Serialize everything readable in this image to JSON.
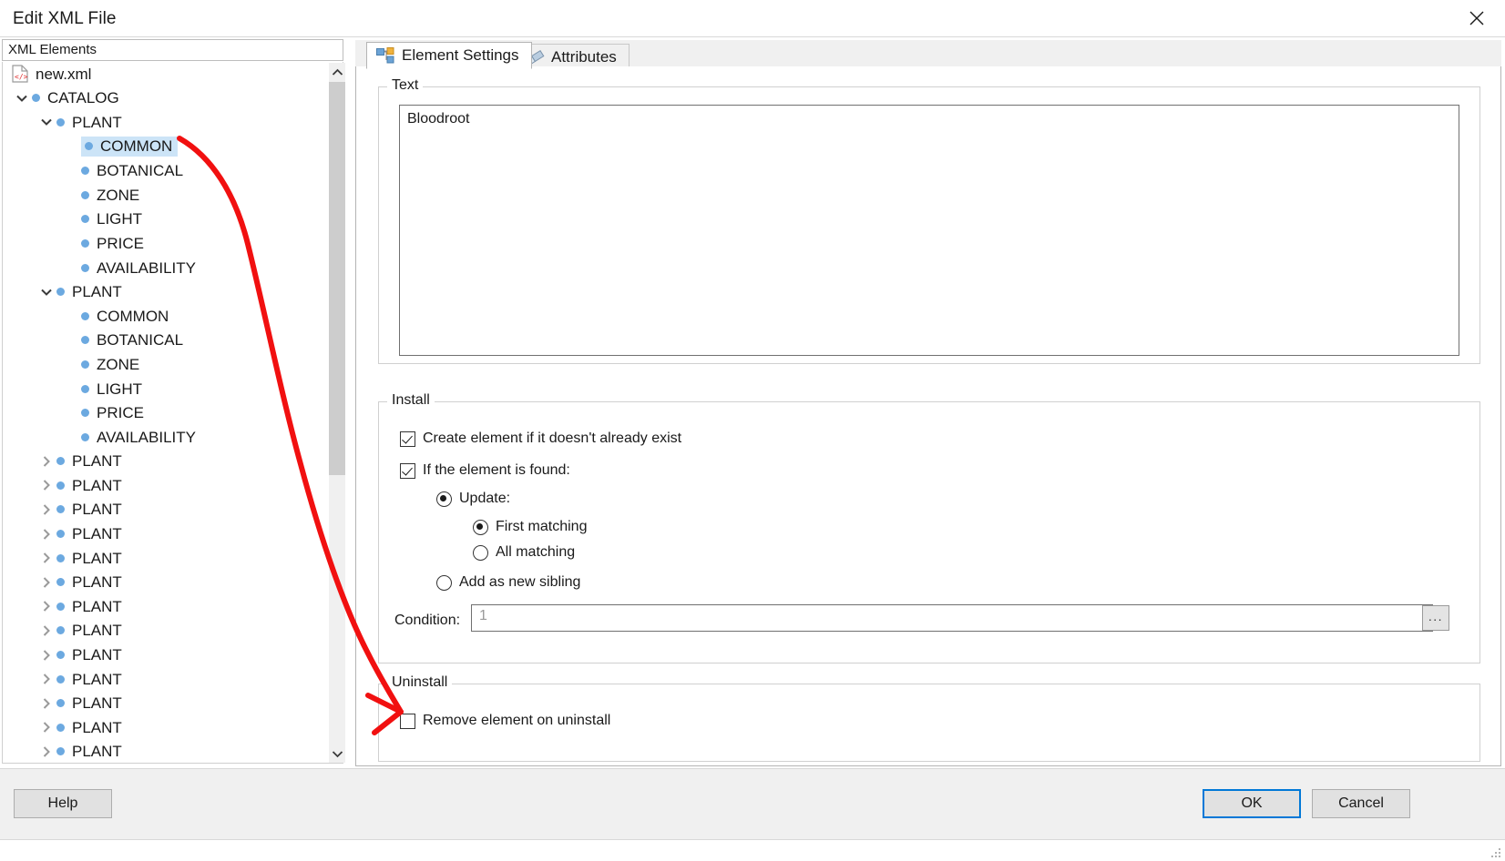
{
  "window": {
    "title": "Edit XML File",
    "close_icon": "close-icon"
  },
  "tree_panel": {
    "header_label": "XML Elements",
    "root": {
      "label": "new.xml",
      "icon": "xml-file-icon"
    },
    "nodes": [
      {
        "label": "CATALOG",
        "depth": 1,
        "state": "expanded",
        "selected": false
      },
      {
        "label": "PLANT",
        "depth": 2,
        "state": "expanded",
        "selected": false
      },
      {
        "label": "COMMON",
        "depth": 3,
        "state": "leaf",
        "selected": true
      },
      {
        "label": "BOTANICAL",
        "depth": 3,
        "state": "leaf",
        "selected": false
      },
      {
        "label": "ZONE",
        "depth": 3,
        "state": "leaf",
        "selected": false
      },
      {
        "label": "LIGHT",
        "depth": 3,
        "state": "leaf",
        "selected": false
      },
      {
        "label": "PRICE",
        "depth": 3,
        "state": "leaf",
        "selected": false
      },
      {
        "label": "AVAILABILITY",
        "depth": 3,
        "state": "leaf",
        "selected": false
      },
      {
        "label": "PLANT",
        "depth": 2,
        "state": "expanded",
        "selected": false
      },
      {
        "label": "COMMON",
        "depth": 3,
        "state": "leaf",
        "selected": false
      },
      {
        "label": "BOTANICAL",
        "depth": 3,
        "state": "leaf",
        "selected": false
      },
      {
        "label": "ZONE",
        "depth": 3,
        "state": "leaf",
        "selected": false
      },
      {
        "label": "LIGHT",
        "depth": 3,
        "state": "leaf",
        "selected": false
      },
      {
        "label": "PRICE",
        "depth": 3,
        "state": "leaf",
        "selected": false
      },
      {
        "label": "AVAILABILITY",
        "depth": 3,
        "state": "leaf",
        "selected": false
      },
      {
        "label": "PLANT",
        "depth": 2,
        "state": "collapsed",
        "selected": false
      },
      {
        "label": "PLANT",
        "depth": 2,
        "state": "collapsed",
        "selected": false
      },
      {
        "label": "PLANT",
        "depth": 2,
        "state": "collapsed",
        "selected": false
      },
      {
        "label": "PLANT",
        "depth": 2,
        "state": "collapsed",
        "selected": false
      },
      {
        "label": "PLANT",
        "depth": 2,
        "state": "collapsed",
        "selected": false
      },
      {
        "label": "PLANT",
        "depth": 2,
        "state": "collapsed",
        "selected": false
      },
      {
        "label": "PLANT",
        "depth": 2,
        "state": "collapsed",
        "selected": false
      },
      {
        "label": "PLANT",
        "depth": 2,
        "state": "collapsed",
        "selected": false
      },
      {
        "label": "PLANT",
        "depth": 2,
        "state": "collapsed",
        "selected": false
      },
      {
        "label": "PLANT",
        "depth": 2,
        "state": "collapsed",
        "selected": false
      },
      {
        "label": "PLANT",
        "depth": 2,
        "state": "collapsed",
        "selected": false
      },
      {
        "label": "PLANT",
        "depth": 2,
        "state": "collapsed",
        "selected": false
      },
      {
        "label": "PLANT",
        "depth": 2,
        "state": "collapsed",
        "selected": false
      }
    ],
    "scrollbar": {
      "up_icon": "chevron-up-icon",
      "down_icon": "chevron-down-icon"
    }
  },
  "tabs": [
    {
      "label": "Element Settings",
      "icon": "element-tree-icon",
      "active": true
    },
    {
      "label": "Attributes",
      "icon": "pencil-icon",
      "active": false
    }
  ],
  "element_settings": {
    "text_group": {
      "legend": "Text",
      "value": "Bloodroot"
    },
    "install_group": {
      "legend": "Install",
      "create_if_missing": {
        "label": "Create element if it doesn't already exist",
        "checked": true
      },
      "if_found": {
        "label": "If the element is found:",
        "checked": true
      },
      "update": {
        "label": "Update:",
        "selected": true
      },
      "first_matching": {
        "label": "First matching",
        "selected": true
      },
      "all_matching": {
        "label": "All matching",
        "selected": false
      },
      "add_as_new_sibling": {
        "label": "Add as new sibling",
        "selected": false
      },
      "condition": {
        "label": "Condition:",
        "value": "1",
        "browse_label": "..."
      }
    },
    "uninstall_group": {
      "legend": "Uninstall",
      "remove_on_uninstall": {
        "label": "Remove element on uninstall",
        "checked": false
      }
    }
  },
  "footer": {
    "help_label": "Help",
    "ok_label": "OK",
    "cancel_label": "Cancel"
  },
  "annotation": {
    "color": "#f11010",
    "description": "red-arrow-to-remove-element-on-uninstall"
  }
}
